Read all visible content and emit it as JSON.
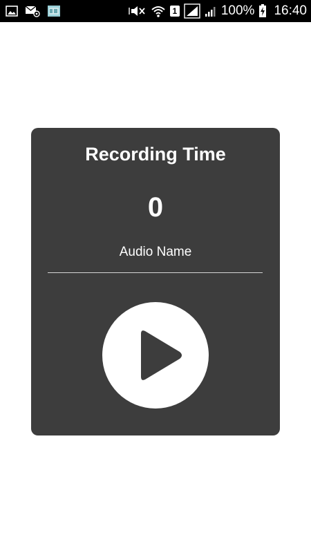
{
  "status_bar": {
    "battery_percent": "100%",
    "time": "16:40",
    "sim_label": "1",
    "left_icons": [
      "image-icon",
      "mail-icon",
      "gallery-icon"
    ],
    "right_icons": [
      "vibrate-mute-icon",
      "wifi-icon",
      "sim-icon",
      "signal-icon",
      "signal-icon-2",
      "battery-charging-icon"
    ]
  },
  "recorder": {
    "title": "Recording Time",
    "time_value": "0",
    "audio_name": "Audio Name",
    "play_icon": "play-icon"
  },
  "colors": {
    "card_background": "#3d3d3d",
    "text": "#ffffff",
    "button_background": "#ffffff",
    "button_icon": "#3d3d3d",
    "status_bar": "#000000"
  }
}
